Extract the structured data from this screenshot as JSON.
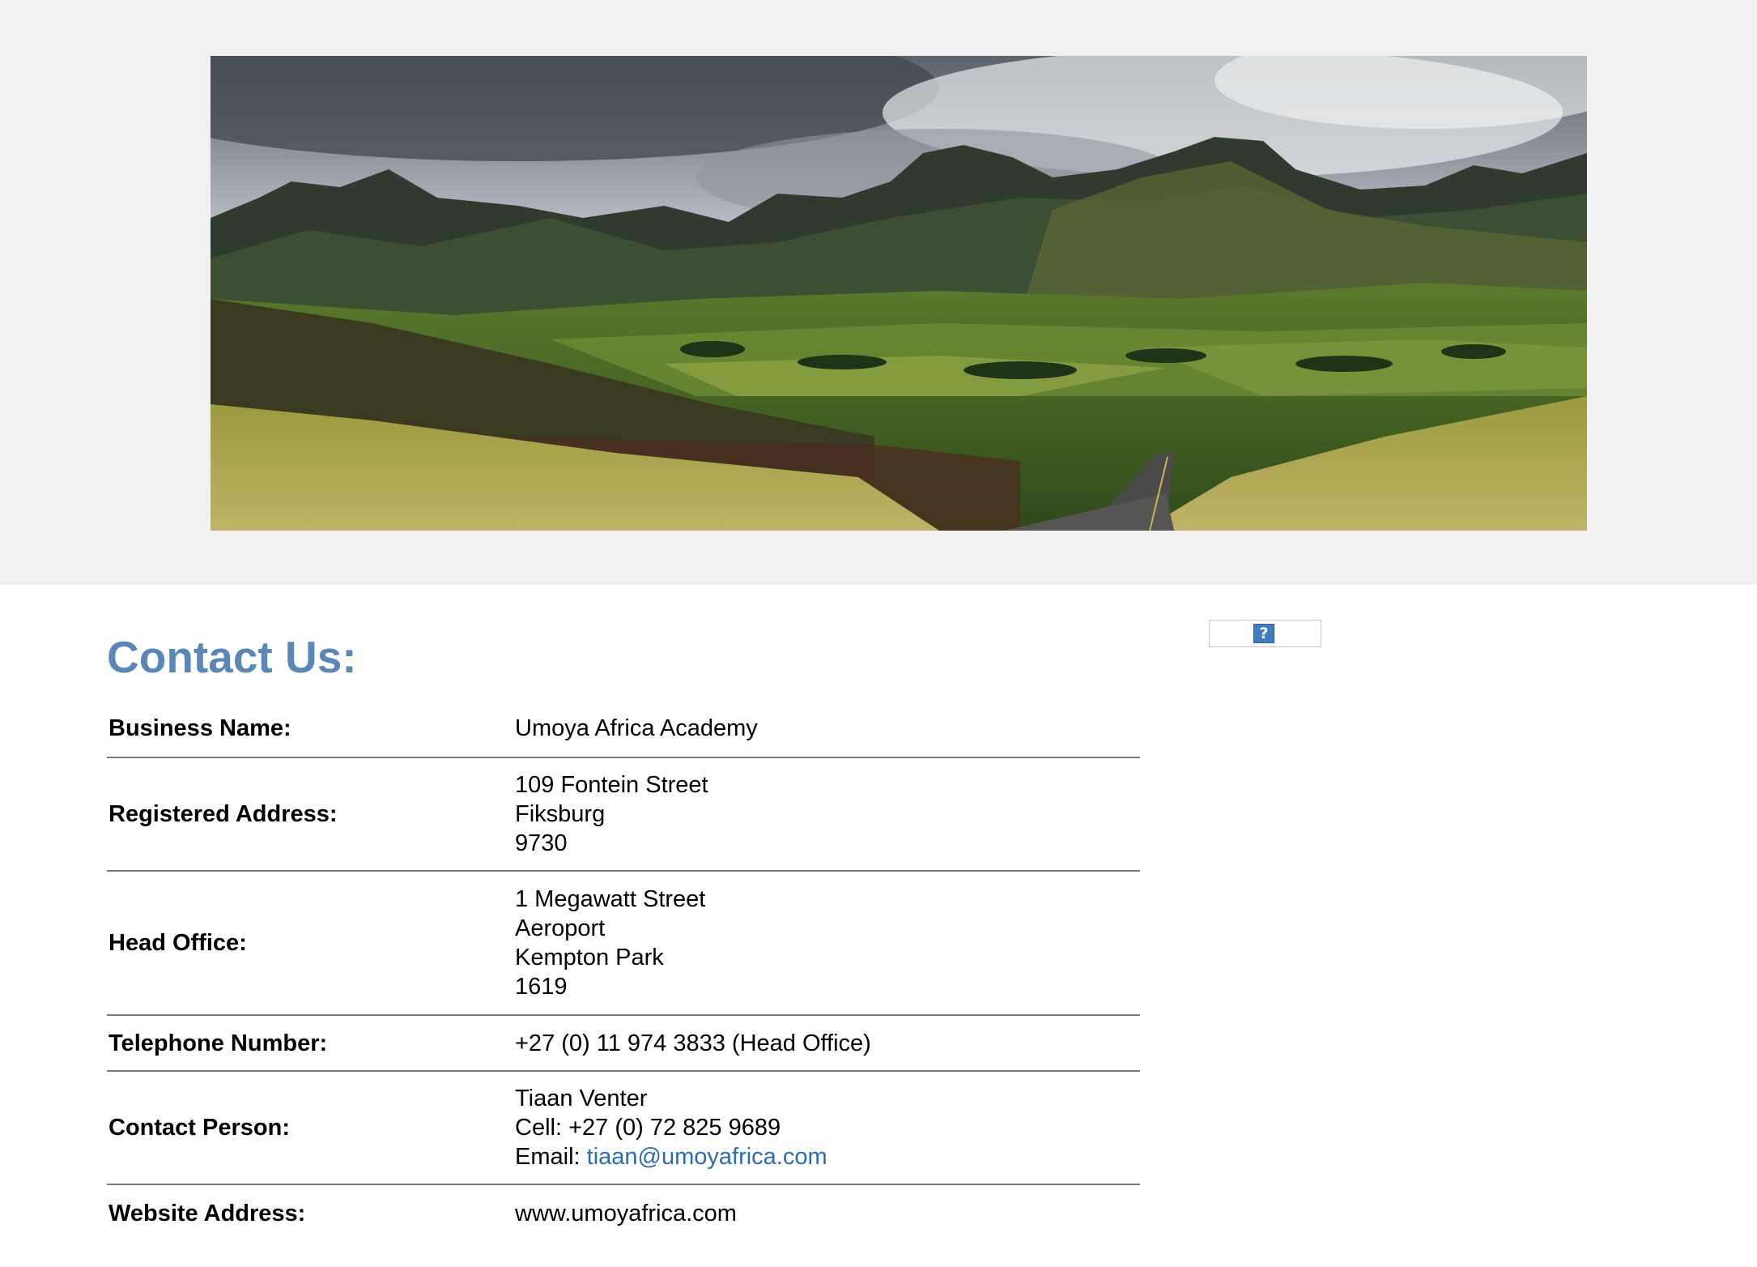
{
  "header": {
    "image_alt": "Mountain landscape with road through green valley"
  },
  "contact": {
    "title": "Contact Us:",
    "rows": [
      {
        "label": "Business Name:",
        "lines": [
          "Umoya Africa Academy"
        ]
      },
      {
        "label": "Registered Address:",
        "lines": [
          "109 Fontein Street",
          "Fiksburg",
          "9730"
        ]
      },
      {
        "label": "Head Office:",
        "lines": [
          "1 Megawatt Street",
          "Aeroport",
          "Kempton Park",
          "1619"
        ]
      },
      {
        "label": "Telephone Number:",
        "lines": [
          "+27 (0) 11 974 3833 (Head Office)"
        ]
      },
      {
        "label": "Contact Person:",
        "lines": [
          "Tiaan Venter",
          "Cell: +27 (0) 72 825 9689"
        ],
        "email_prefix": "Email: ",
        "email": "tiaan@umoyafrica.com"
      },
      {
        "label": "Website Address:",
        "lines": [
          "www.umoyafrica.com"
        ]
      }
    ]
  },
  "widget": {
    "icon": "missing-plugin-icon",
    "glyph": "?"
  },
  "colors": {
    "title": "#5a87b6",
    "link": "#2a6db5",
    "band": "#f0f0f0"
  }
}
